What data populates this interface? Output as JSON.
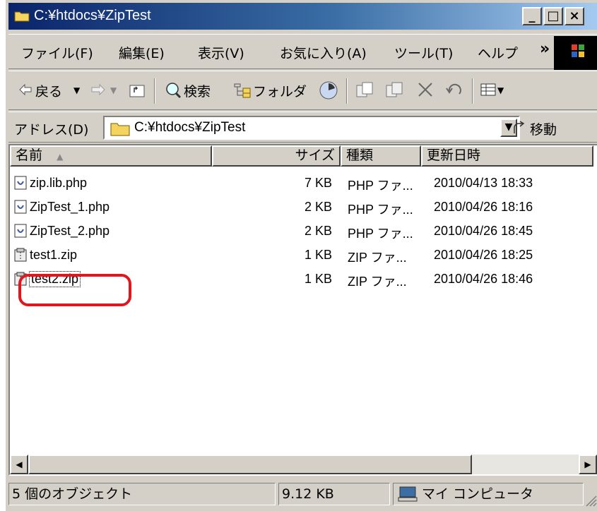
{
  "window": {
    "title": "C:¥htdocs¥ZipTest"
  },
  "caption_buttons": {
    "minimize": "_",
    "maximize": "□",
    "close": "×"
  },
  "menubar": {
    "items": [
      {
        "label": "ファイル(F)"
      },
      {
        "label": "編集(E)"
      },
      {
        "label": "表示(V)"
      },
      {
        "label": "お気に入り(A)"
      },
      {
        "label": "ツール(T)"
      },
      {
        "label": "ヘルプ"
      }
    ],
    "overflow": "»"
  },
  "toolbar": {
    "back_label": "戻る",
    "search_label": "検索",
    "folders_label": "フォルダ"
  },
  "address": {
    "label": "アドレス(D)",
    "value": "C:¥htdocs¥ZipTest",
    "go_label": "移動"
  },
  "columns": [
    "名前",
    "サイズ",
    "種類",
    "更新日時"
  ],
  "files": [
    {
      "name": "zip.lib.php",
      "size": "7 KB",
      "type": "PHP ファ...",
      "modified": "2010/04/13 18:33",
      "icon": "php-file-icon"
    },
    {
      "name": "ZipTest_1.php",
      "size": "2 KB",
      "type": "PHP ファ...",
      "modified": "2010/04/26 18:16",
      "icon": "php-file-icon"
    },
    {
      "name": "ZipTest_2.php",
      "size": "2 KB",
      "type": "PHP ファ...",
      "modified": "2010/04/26 18:45",
      "icon": "php-file-icon"
    },
    {
      "name": "test1.zip",
      "size": "1 KB",
      "type": "ZIP ファ...",
      "modified": "2010/04/26 18:25",
      "icon": "zip-file-icon"
    },
    {
      "name": "test2.zip",
      "size": "1 KB",
      "type": "ZIP ファ...",
      "modified": "2010/04/26 18:46",
      "icon": "zip-file-icon",
      "highlighted": true
    }
  ],
  "status": {
    "objects": "5 個のオブジェクト",
    "size": "9.12 KB",
    "zone": "マイ コンピュータ"
  },
  "colors": {
    "highlight_ring": "#e0171f",
    "title_start": "#0a246a",
    "title_end": "#a6caf0"
  }
}
